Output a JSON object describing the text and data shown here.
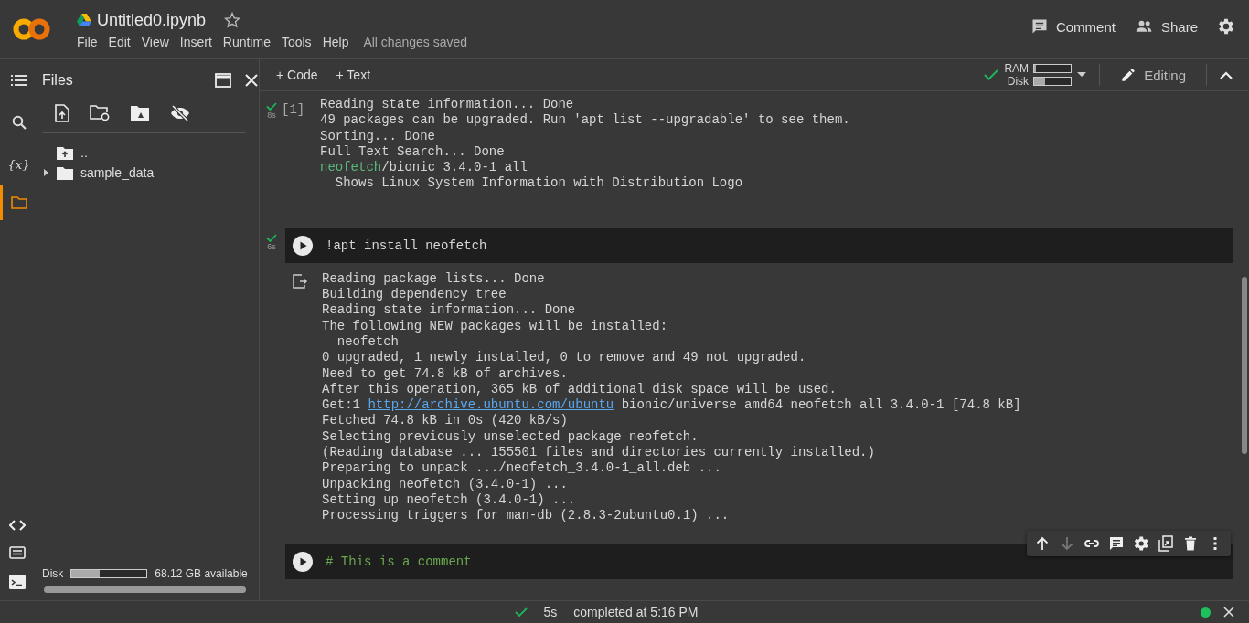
{
  "header": {
    "file_name": "Untitled0.ipynb",
    "starred": false,
    "menu": [
      "File",
      "Edit",
      "View",
      "Insert",
      "Runtime",
      "Tools",
      "Help"
    ],
    "save_status": "All changes saved",
    "comment": "Comment",
    "share": "Share"
  },
  "rail": [
    {
      "kind": "menu",
      "selected": false
    },
    {
      "kind": "search",
      "selected": false
    },
    {
      "kind": "variables",
      "label": "{x}",
      "selected": false
    },
    {
      "kind": "files",
      "selected": true
    }
  ],
  "rail_bottom": [
    {
      "kind": "code"
    },
    {
      "kind": "palette"
    },
    {
      "kind": "terminal"
    }
  ],
  "files": {
    "title": "Files",
    "tree": [
      {
        "kind": "parent",
        "name": ".."
      },
      {
        "kind": "folder",
        "name": "sample_data",
        "expanded": false
      }
    ],
    "disk": {
      "label": "Disk",
      "level": 0.37,
      "available": "68.12 GB available"
    }
  },
  "toolbar": {
    "add_code": "+ Code",
    "add_text": "+ Text",
    "ram": {
      "label": "RAM",
      "level": 0.05
    },
    "disk": {
      "label": "Disk",
      "level": 0.3
    },
    "connected": true,
    "mode": "Editing"
  },
  "cells": [
    {
      "kind": "output",
      "count": "[1]",
      "done": true,
      "time": "8s",
      "output": [
        {
          "text": "Reading state information... Done"
        },
        {
          "text": "49 packages can be upgraded. Run 'apt list --upgradable' to see them."
        },
        {
          "text": "Sorting... Done"
        },
        {
          "text": "Full Text Search... Done"
        },
        {
          "pkg": "neofetch",
          "text": "/bionic 3.4.0-1 all"
        },
        {
          "text": "  Shows Linux System Information with Distribution Logo"
        }
      ]
    },
    {
      "kind": "code",
      "code": "!apt install neofetch",
      "done": true,
      "time": "6s",
      "output": [
        {
          "text": "Reading package lists... Done"
        },
        {
          "text": "Building dependency tree"
        },
        {
          "text": "Reading state information... Done"
        },
        {
          "text": "The following NEW packages will be installed:"
        },
        {
          "text": "  neofetch"
        },
        {
          "text": "0 upgraded, 1 newly installed, 0 to remove and 49 not upgraded."
        },
        {
          "text": "Need to get 74.8 kB of archives."
        },
        {
          "text": "After this operation, 365 kB of additional disk space will be used."
        },
        {
          "text": "Get:1 ",
          "link": "http://archive.ubuntu.com/ubuntu",
          "rest": " bionic/universe amd64 neofetch all 3.4.0-1 [74.8 kB]"
        },
        {
          "text": "Fetched 74.8 kB in 0s (420 kB/s)"
        },
        {
          "text": "Selecting previously unselected package neofetch."
        },
        {
          "text": "(Reading database ... 155501 files and directories currently installed.)"
        },
        {
          "text": "Preparing to unpack .../neofetch_3.4.0-1_all.deb ..."
        },
        {
          "text": "Unpacking neofetch (3.4.0-1) ..."
        },
        {
          "text": "Setting up neofetch (3.4.0-1) ..."
        },
        {
          "text": "Processing triggers for man-db (2.8.3-2ubuntu0.1) ..."
        }
      ]
    },
    {
      "kind": "comment",
      "code": "# This is a comment"
    }
  ],
  "cell_toolbar": [
    {
      "kind": "up",
      "disabled": false
    },
    {
      "kind": "down",
      "disabled": true
    },
    {
      "kind": "link",
      "disabled": false
    },
    {
      "kind": "comment",
      "disabled": false
    },
    {
      "kind": "settings",
      "disabled": false
    },
    {
      "kind": "mirror",
      "disabled": false
    },
    {
      "kind": "delete",
      "disabled": false
    },
    {
      "kind": "more",
      "disabled": false
    }
  ],
  "status_bar": {
    "done": true,
    "time": "5s",
    "text": "completed at 5:16 PM",
    "connected": true
  }
}
